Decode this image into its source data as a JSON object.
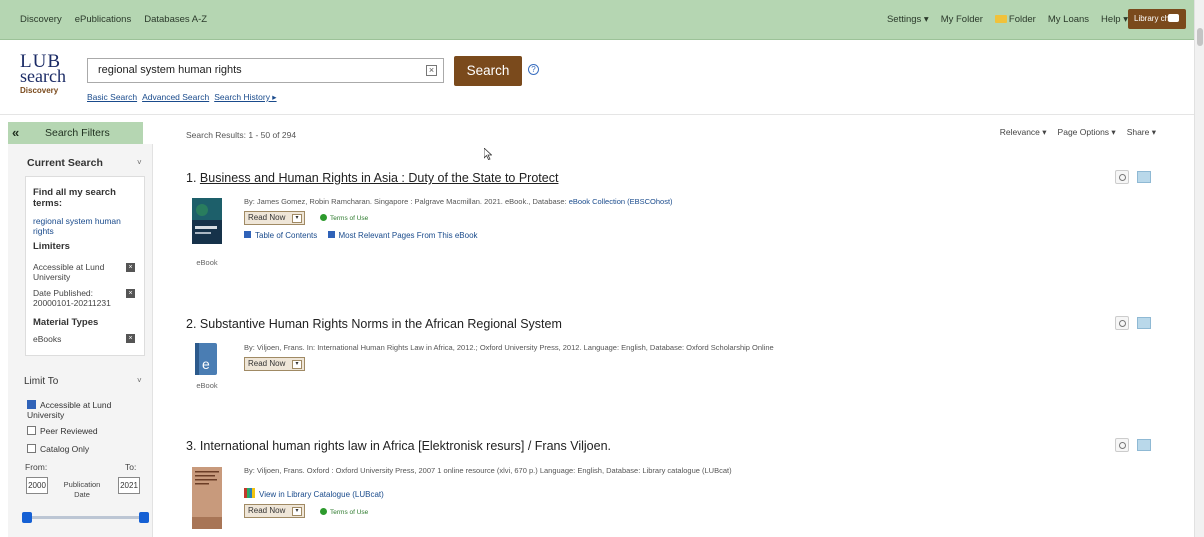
{
  "topnav": {
    "left_links": [
      "Discovery",
      "ePublications",
      "Databases A-Z"
    ],
    "settings": "Settings ▾",
    "my_folder": "My Folder",
    "folder": "Folder",
    "my_loans": "My Loans",
    "help": "Help ▾",
    "chat": "Library chat"
  },
  "logo": {
    "line1": "LUB",
    "line2": "search",
    "line3": "Discovery"
  },
  "search": {
    "query": "regional system human rights",
    "button": "Search",
    "links": [
      "Basic Search",
      "Advanced Search",
      "Search History ▸"
    ]
  },
  "sidebar": {
    "filters_label": "Search Filters",
    "current_search": "Current Search",
    "find_all": "Find all my search terms:",
    "terms": "regional system human rights",
    "limiters": "Limiters",
    "limiter1": "Accessible at Lund University",
    "limiter2": "Date Published: 20000101-20211231",
    "material_types": "Material Types",
    "mt1": "eBooks",
    "limit_to": "Limit To",
    "cb1": "Accessible at Lund University",
    "cb2": "Peer Reviewed",
    "cb3": "Catalog Only",
    "from": "From:",
    "to": "To:",
    "from_val": "2000",
    "to_val": "2021",
    "pub_date": "Publication Date"
  },
  "results_meta": {
    "count": "Search Results: 1 - 50 of 294",
    "relevance": "Relevance ▾",
    "page_options": "Page Options ▾",
    "share": "Share ▾"
  },
  "results": [
    {
      "num": "1.",
      "title": "Business and Human Rights in Asia : Duty of the State to Protect",
      "by": "By: James Gomez, Robin Ramcharan. Singapore : Palgrave Macmillan. 2021. eBook., Database: ",
      "db": "eBook Collection (EBSCOhost)",
      "read": "Read Now",
      "terms": "Terms of Use",
      "toc": "Table of Contents",
      "mrp": "Most Relevant Pages From This eBook",
      "format": "eBook"
    },
    {
      "num": "2.",
      "title": "Substantive Human Rights Norms in the African Regional System",
      "by": "By: Viljoen, Frans. In: International Human Rights Law in Africa, 2012.; Oxford University Press, 2012. Language: English, Database: Oxford Scholarship Online",
      "read": "Read Now",
      "format": "eBook"
    },
    {
      "num": "3.",
      "title": "International human rights law in Africa [Elektronisk resurs] / Frans Viljoen.",
      "by": "By: Viljoen, Frans. Oxford : Oxford University Press, 2007 1 online resource (xlvi, 670 p.) Language: English, Database: Library catalogue (LUBcat)",
      "catalogue": "View in Library Catalogue (LUBcat)",
      "read": "Read Now",
      "terms": "Terms of Use"
    }
  ]
}
